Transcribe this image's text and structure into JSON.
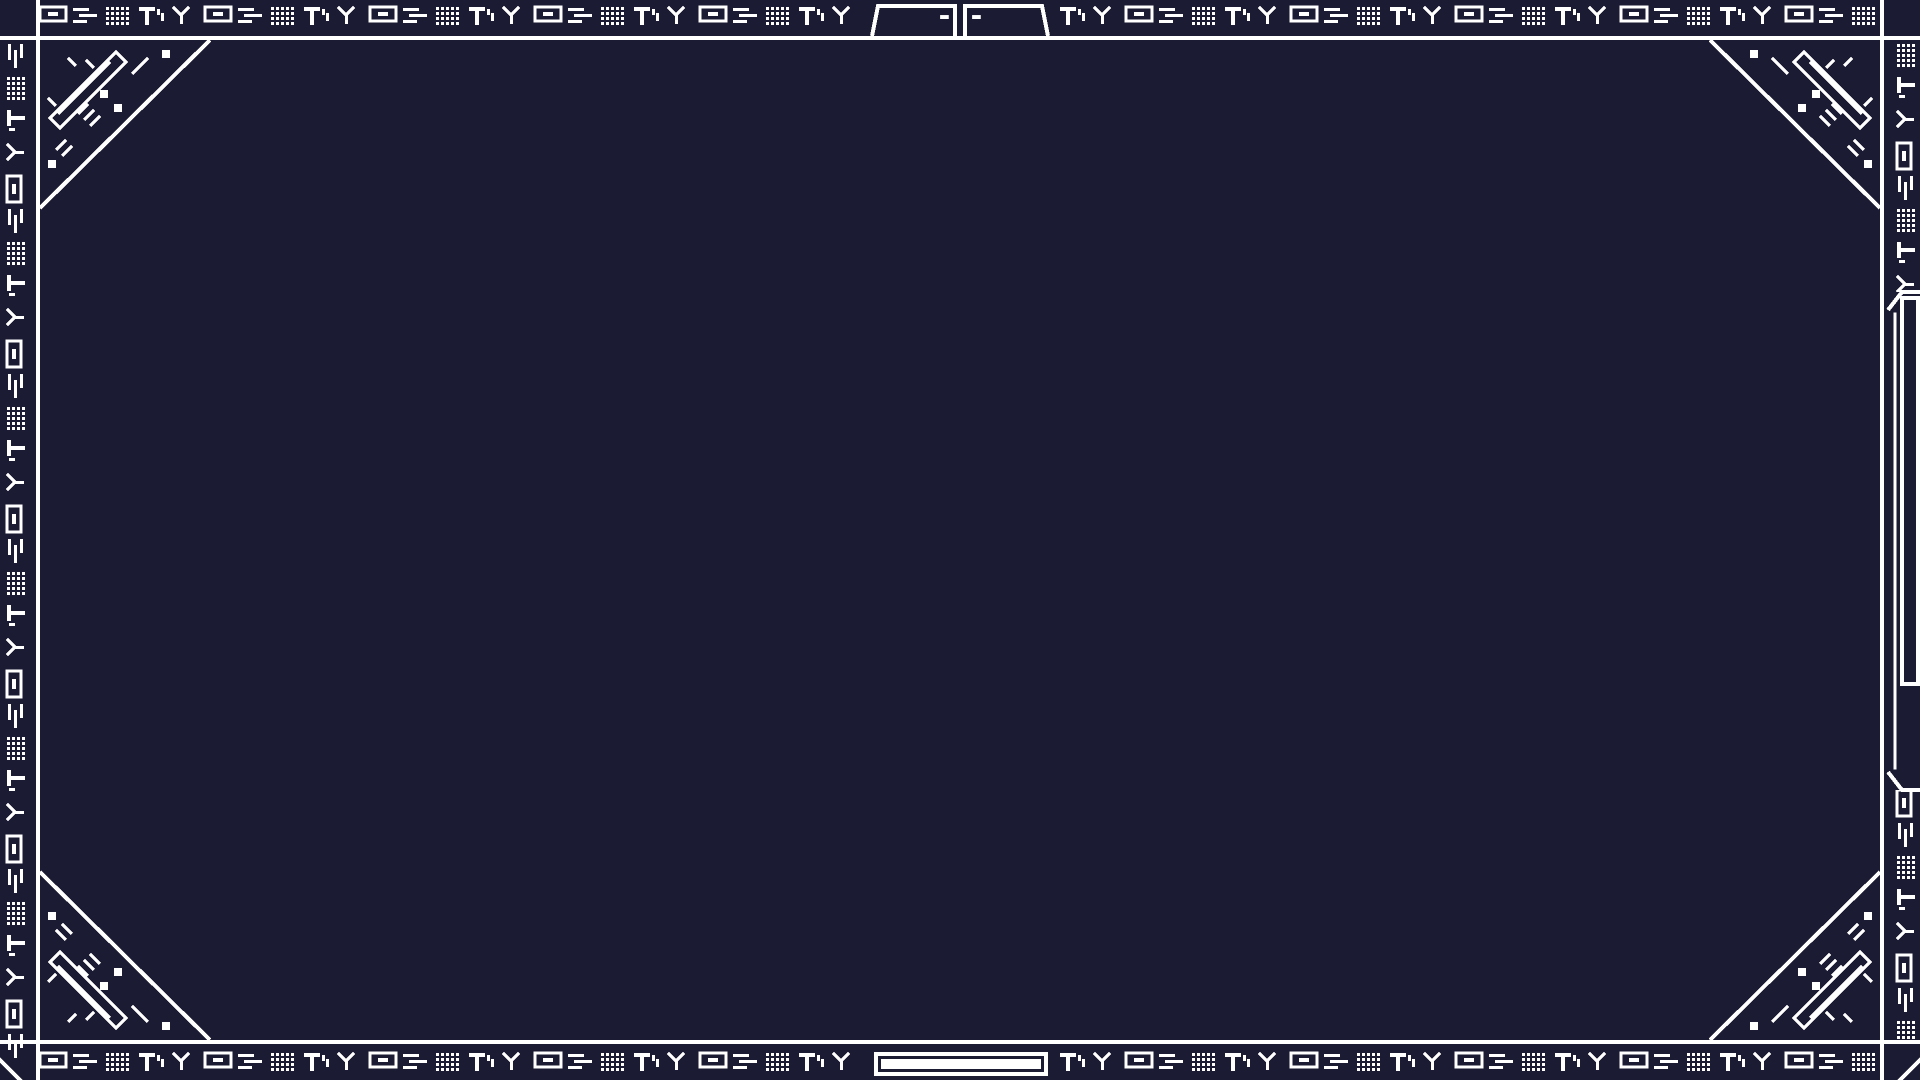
{
  "screen": {
    "name": "hud-frame-overlay",
    "colors": {
      "background": "#1b1b33",
      "line": "#ffffff"
    },
    "tab": {
      "left_marker": "-",
      "right_marker": "-"
    },
    "scrollbar": {
      "position": 0.0,
      "visible_fraction": 0.51
    },
    "bottom_bar": {
      "fill": 1.0
    },
    "icons": [
      "corner-circuit-ornament-icon",
      "glyph-border-pattern-icon"
    ]
  }
}
